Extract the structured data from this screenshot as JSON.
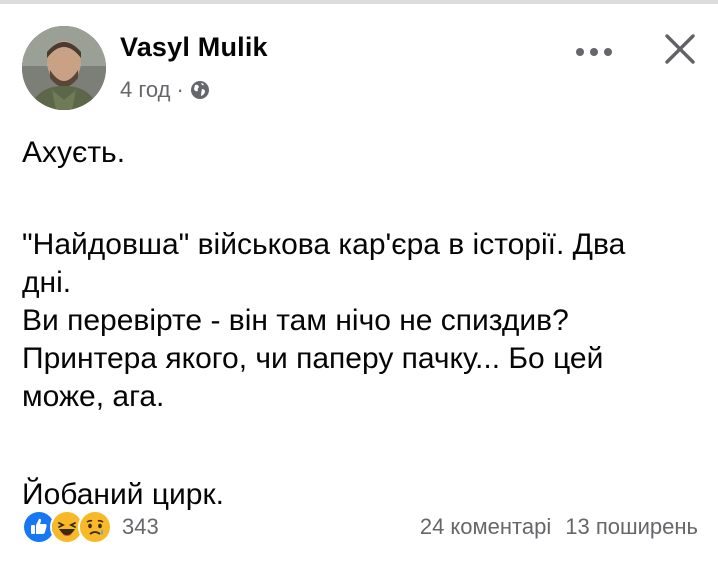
{
  "post": {
    "author_name": "Vasyl Mulik",
    "time_ago": "4 год",
    "meta_separator": "·",
    "privacy_icon": "globe-icon",
    "more_icon": "more-horizontal-icon",
    "close_icon": "close-icon",
    "body_lines": [
      "Ахуєть.",
      "\"Найдовша\" військова кар'єра в історії. Два",
      "дні.",
      "Ви перевірте - він там нічо не спиздив?",
      "Принтера якого, чи паперу пачку... Бо цей",
      "може, ага.",
      "Йобаний цирк."
    ],
    "reactions": {
      "icons": [
        "like-reaction-icon",
        "haha-reaction-icon",
        "sad-reaction-icon"
      ],
      "count": "343"
    },
    "comments_label": "24 коментарі",
    "shares_label": "13 поширень"
  },
  "colors": {
    "secondary_text": "#65676b",
    "like_blue": "#1877f2",
    "emoji_yellow": "#f7b928"
  }
}
